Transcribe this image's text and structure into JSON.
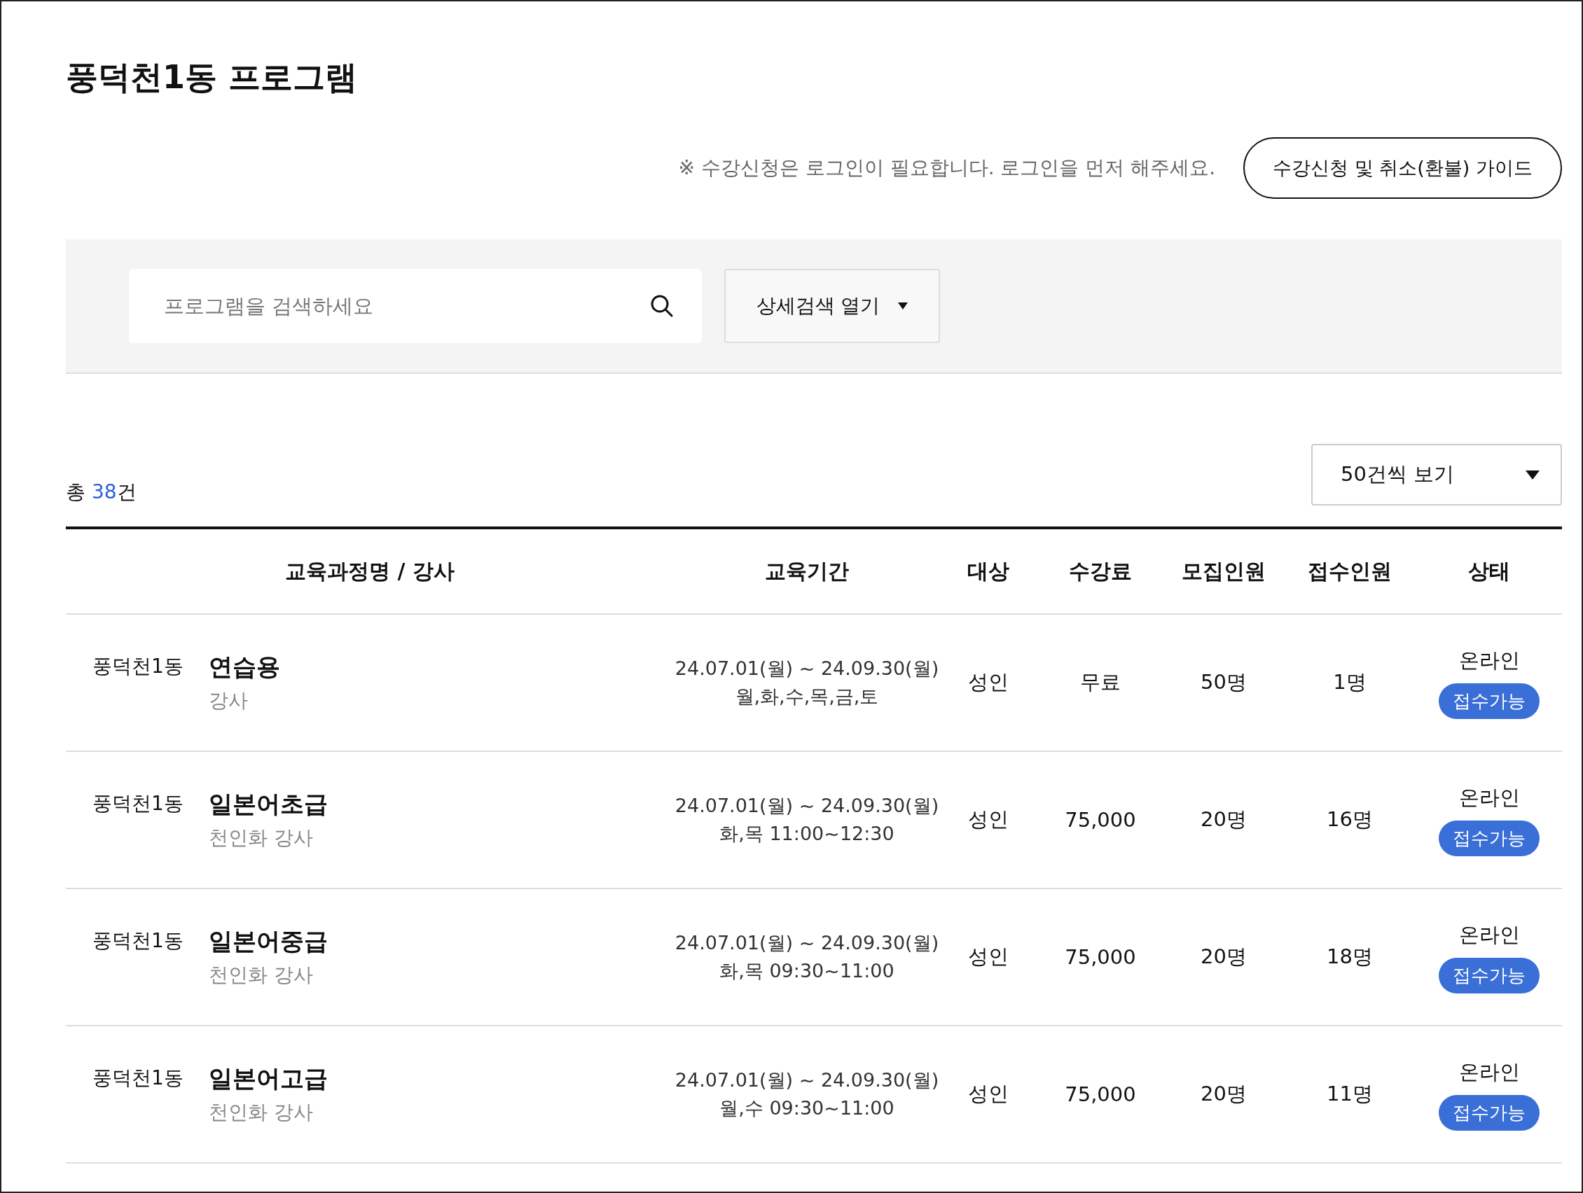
{
  "title": "풍덕천1동 프로그램",
  "notice": "※ 수강신청은 로그인이 필요합니다. 로그인을 먼저 해주세요.",
  "guide_button": "수강신청 및 취소(환불) 가이드",
  "search": {
    "placeholder": "프로그램을 검색하세요"
  },
  "detail_search_button": "상세검색 열기",
  "total": {
    "prefix": "총 ",
    "count": "38",
    "suffix": "건"
  },
  "page_size": {
    "value": "50건씩 보기"
  },
  "columns": [
    "교육과정명 / 강사",
    "교육기간",
    "대상",
    "수강료",
    "모집인원",
    "접수인원",
    "상태"
  ],
  "rows": [
    {
      "dong": "풍덕천1동",
      "title": "연습용",
      "instructor": "강사",
      "period": "24.07.01(월) ~ 24.09.30(월)",
      "schedule": "월,화,수,목,금,토",
      "target": "성인",
      "fee": "무료",
      "capacity": "50명",
      "applied": "1명",
      "method": "온라인",
      "status": {
        "label": "접수가능",
        "kind": "open"
      }
    },
    {
      "dong": "풍덕천1동",
      "title": "일본어초급",
      "instructor": "천인화 강사",
      "period": "24.07.01(월) ~ 24.09.30(월)",
      "schedule": "화,목 11:00~12:30",
      "target": "성인",
      "fee": "75,000",
      "capacity": "20명",
      "applied": "16명",
      "method": "온라인",
      "status": {
        "label": "접수가능",
        "kind": "open"
      }
    },
    {
      "dong": "풍덕천1동",
      "title": "일본어중급",
      "instructor": "천인화 강사",
      "period": "24.07.01(월) ~ 24.09.30(월)",
      "schedule": "화,목 09:30~11:00",
      "target": "성인",
      "fee": "75,000",
      "capacity": "20명",
      "applied": "18명",
      "method": "온라인",
      "status": {
        "label": "접수가능",
        "kind": "open"
      }
    },
    {
      "dong": "풍덕천1동",
      "title": "일본어고급",
      "instructor": "천인화 강사",
      "period": "24.07.01(월) ~ 24.09.30(월)",
      "schedule": "월,수 09:30~11:00",
      "target": "성인",
      "fee": "75,000",
      "capacity": "20명",
      "applied": "11명",
      "method": "온라인",
      "status": {
        "label": "접수가능",
        "kind": "open"
      }
    }
  ]
}
